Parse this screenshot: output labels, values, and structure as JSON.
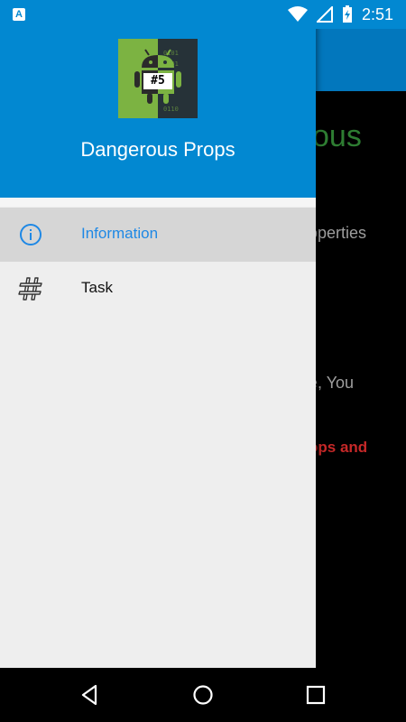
{
  "status_bar": {
    "time": "2:51",
    "notification_icon": "accessibility-app-icon",
    "notification_glyph": "A",
    "icons": [
      "wifi-icon",
      "cell-signal-icon",
      "battery-charging-icon"
    ]
  },
  "background_app": {
    "title_partial": "ous",
    "line1_partial": "operties",
    "line2_partial": "e, You",
    "line3_partial": "ops and",
    "colors": {
      "appbar": "#0277bd",
      "title": "#2e7d32",
      "warning": "#c62828"
    }
  },
  "drawer": {
    "header_title": "Dangerous Props",
    "logo_badge_text": "#5",
    "header_color": "#0288d1",
    "items": [
      {
        "label": "Information",
        "icon": "info-icon",
        "selected": true
      },
      {
        "label": "Task",
        "icon": "hashtag-icon",
        "selected": false
      }
    ],
    "accent_color": "#1e88e5"
  },
  "nav_bar": {
    "buttons": [
      "back-icon",
      "home-icon",
      "recents-icon"
    ]
  }
}
